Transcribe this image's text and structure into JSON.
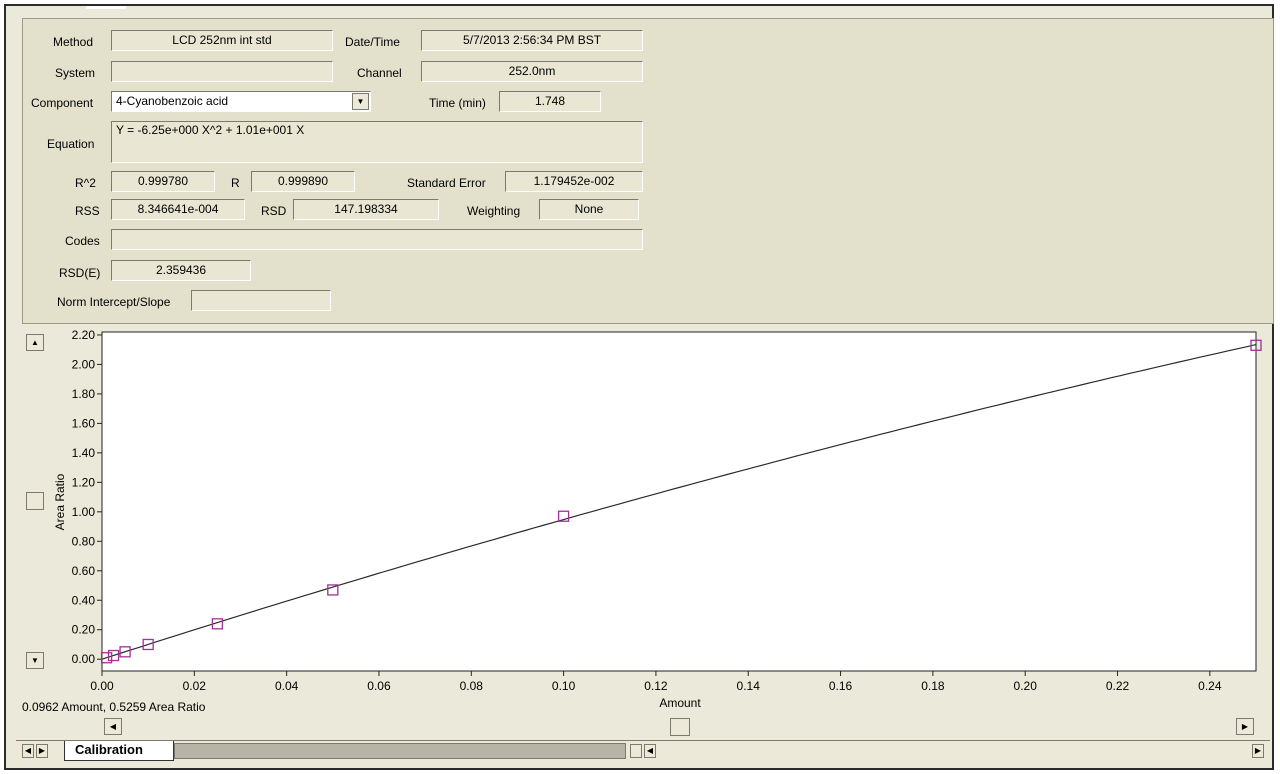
{
  "form": {
    "method_label": "Method",
    "method_value": "LCD 252nm int std",
    "datetime_label": "Date/Time",
    "datetime_value": "5/7/2013 2:56:34 PM BST",
    "system_label": "System",
    "system_value": "",
    "channel_label": "Channel",
    "channel_value": "252.0nm",
    "component_label": "Component",
    "component_value": "4-Cyanobenzoic acid",
    "time_label": "Time (min)",
    "time_value": "1.748",
    "equation_label": "Equation",
    "equation_value": "Y = -6.25e+000 X^2 + 1.01e+001 X",
    "r2_label": "R^2",
    "r2_value": "0.999780",
    "r_label": "R",
    "r_value": "0.999890",
    "stderr_label": "Standard Error",
    "stderr_value": "1.179452e-002",
    "rss_label": "RSS",
    "rss_value": "8.346641e-004",
    "rsd_label": "RSD",
    "rsd_value": "147.198334",
    "weighting_label": "Weighting",
    "weighting_value": "None",
    "codes_label": "Codes",
    "codes_value": "",
    "rsde_label": "RSD(E)",
    "rsde_value": "2.359436",
    "norm_label": "Norm Intercept/Slope",
    "norm_value": ""
  },
  "status": {
    "cursor_readout": "0.0962 Amount, 0.5259 Area Ratio"
  },
  "tabs": [
    {
      "label": "Calibration"
    }
  ],
  "chart_data": {
    "type": "scatter",
    "xlabel": "Amount",
    "ylabel": "Area Ratio",
    "xlim": [
      0,
      0.25
    ],
    "ylim": [
      -0.08,
      2.22
    ],
    "x_ticks": [
      "0.00",
      "0.02",
      "0.04",
      "0.06",
      "0.08",
      "0.10",
      "0.12",
      "0.14",
      "0.16",
      "0.18",
      "0.20",
      "0.22",
      "0.24"
    ],
    "x_tick_values": [
      0,
      0.02,
      0.04,
      0.06,
      0.08,
      0.1,
      0.12,
      0.14,
      0.16,
      0.18,
      0.2,
      0.22,
      0.24
    ],
    "y_ticks": [
      "0.00",
      "0.20",
      "0.40",
      "0.60",
      "0.80",
      "1.00",
      "1.20",
      "1.40",
      "1.60",
      "1.80",
      "2.00",
      "2.20"
    ],
    "y_tick_values": [
      0,
      0.2,
      0.4,
      0.6,
      0.8,
      1.0,
      1.2,
      1.4,
      1.6,
      1.8,
      2.0,
      2.2
    ],
    "points": [
      {
        "x": 0.001,
        "y": 0.01
      },
      {
        "x": 0.0025,
        "y": 0.025
      },
      {
        "x": 0.005,
        "y": 0.05
      },
      {
        "x": 0.01,
        "y": 0.1
      },
      {
        "x": 0.025,
        "y": 0.24
      },
      {
        "x": 0.05,
        "y": 0.47
      },
      {
        "x": 0.1,
        "y": 0.97
      },
      {
        "x": 0.25,
        "y": 2.13
      }
    ],
    "fit": {
      "a": -6.25,
      "b": 10.1
    },
    "point_color": "#a0309a",
    "line_color": "#2a2a2a",
    "grid": false
  }
}
